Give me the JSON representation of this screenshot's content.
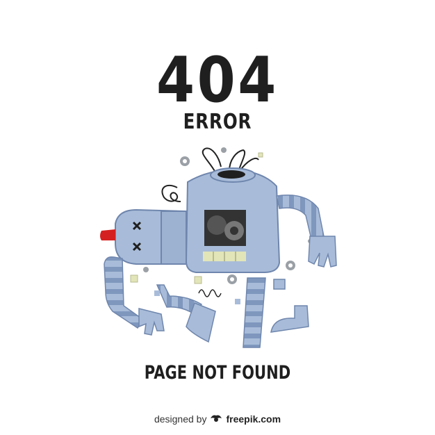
{
  "error": {
    "code": "404",
    "label": "ERROR",
    "message": "PAGE NOT FOUND"
  },
  "footer": {
    "prefix": "designed by",
    "brand": "freepik.com",
    "icon": "freepik-logo-icon"
  },
  "colors": {
    "text": "#1f1f1f",
    "robot_body": "#a8bcd9",
    "robot_stripe": "#7f97bd",
    "robot_outline": "#6f86ad",
    "screen_bg": "#333333",
    "gear": "#9aa0a6",
    "nose_red": "#d42020",
    "mouth": "#e2e5b8"
  }
}
